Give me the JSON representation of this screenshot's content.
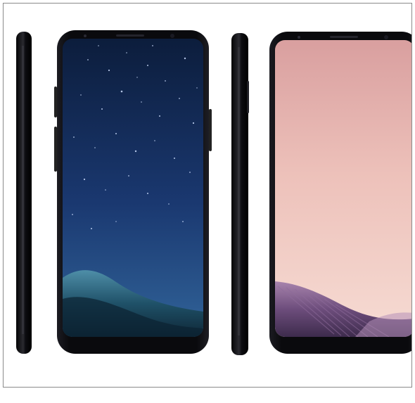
{
  "scene": {
    "subject": "product-photo-two-smartphones",
    "phones": [
      {
        "id": "phone-1",
        "screen_theme": "night-sky-blue",
        "body_color": "#0b0b0e"
      },
      {
        "id": "phone-2",
        "screen_theme": "orchid-pink",
        "body_color": "#0d0c10"
      }
    ],
    "colors": {
      "background": "#ffffff",
      "frame_border": "#8a8a8a",
      "night_top": "#0d1f3f",
      "night_mid": "#1a3768",
      "night_bottom": "#2f5a8f",
      "pink_top": "#d9a2a2",
      "pink_mid": "#efc7c0",
      "pink_bottom": "#f4d7cf",
      "hill_blue": "#1f5d73",
      "hill_purple": "#6a4e78"
    }
  }
}
